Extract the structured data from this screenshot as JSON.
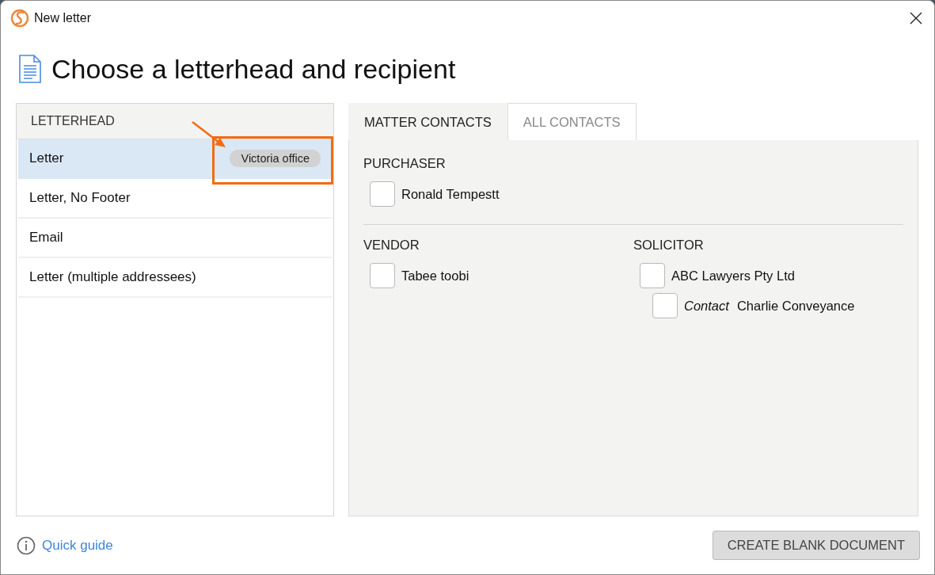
{
  "window": {
    "title": "New letter"
  },
  "heading": "Choose a letterhead and recipient",
  "letterhead": {
    "header": "LETTERHEAD",
    "items": [
      {
        "label": "Letter",
        "selected": true,
        "badge": "Victoria office"
      },
      {
        "label": "Letter, No Footer",
        "selected": false
      },
      {
        "label": "Email",
        "selected": false
      },
      {
        "label": "Letter (multiple addressees)",
        "selected": false
      }
    ]
  },
  "recipients": {
    "tabs": [
      {
        "label": "MATTER CONTACTS",
        "selected": true
      },
      {
        "label": "ALL CONTACTS",
        "selected": false
      }
    ],
    "sections": [
      {
        "groups": [
          {
            "heading": "PURCHASER",
            "contacts": [
              {
                "name": "Ronald Tempestt",
                "checked": false
              }
            ]
          }
        ]
      },
      {
        "groups": [
          {
            "heading": "VENDOR",
            "contacts": [
              {
                "name": "Tabee toobi",
                "checked": false
              }
            ]
          },
          {
            "heading": "SOLICITOR",
            "contacts": [
              {
                "name": "ABC Lawyers Pty Ltd",
                "checked": false,
                "children": [
                  {
                    "role": "Contact",
                    "name": "Charlie Conveyance",
                    "checked": false
                  }
                ]
              }
            ]
          }
        ]
      }
    ]
  },
  "footer": {
    "link": "Quick guide",
    "button": "CREATE BLANK DOCUMENT"
  }
}
